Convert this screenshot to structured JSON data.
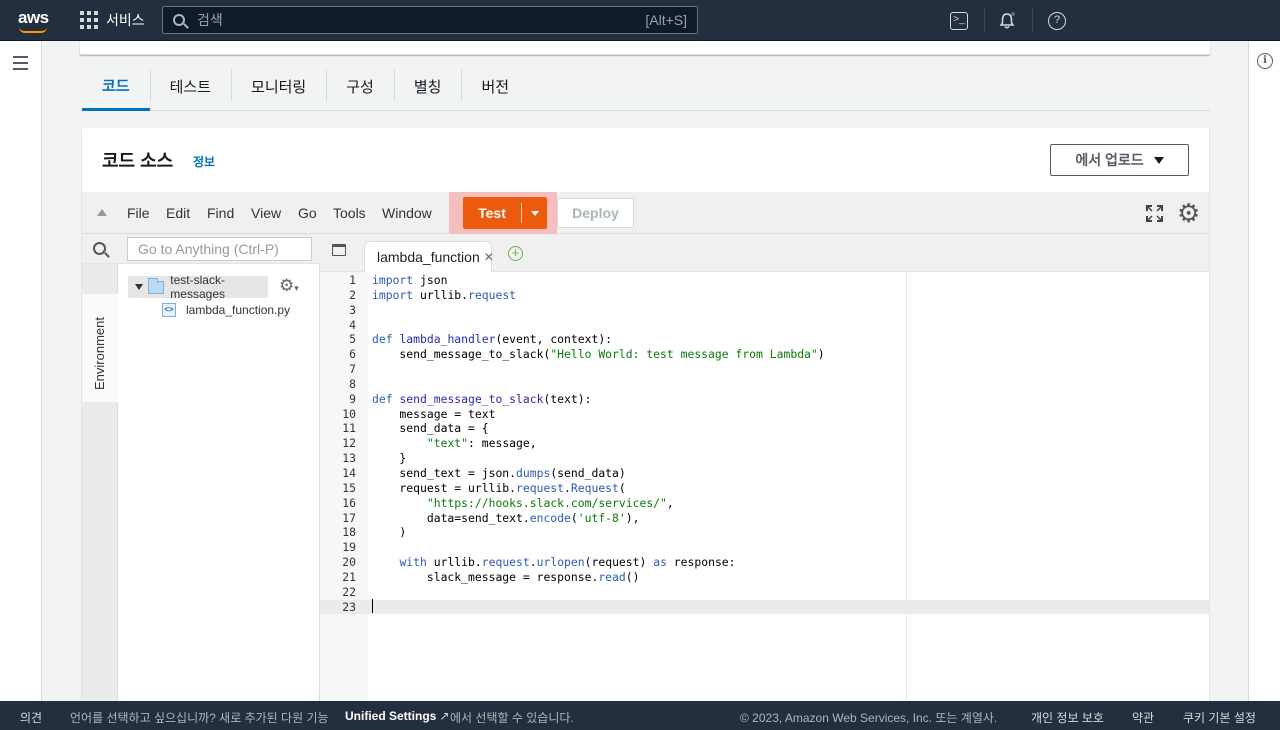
{
  "topnav": {
    "logo": "aws",
    "services_label": "서비스",
    "search_placeholder": "검색",
    "search_shortcut": "[Alt+S]",
    "icons": [
      "cloudshell-icon",
      "bell-icon",
      "help-icon"
    ]
  },
  "tabs": [
    {
      "label": "코드",
      "active": true
    },
    {
      "label": "테스트"
    },
    {
      "label": "모니터링"
    },
    {
      "label": "구성"
    },
    {
      "label": "별칭"
    },
    {
      "label": "버전"
    }
  ],
  "code_source": {
    "title": "코드 소스",
    "info_link": "정보",
    "upload_button": "에서 업로드"
  },
  "ide": {
    "menu": [
      "File",
      "Edit",
      "Find",
      "View",
      "Go",
      "Tools",
      "Window"
    ],
    "test_button": "Test",
    "deploy_button": "Deploy",
    "goto_placeholder": "Go to Anything (Ctrl-P)",
    "environment_tab": "Environment",
    "folder_name": "test-slack-messages",
    "file_name": "lambda_function.py",
    "editor_tab": "lambda_function",
    "active_line": 23,
    "code": [
      "import json",
      "import urllib.request",
      "",
      "",
      "def lambda_handler(event, context):",
      "    send_message_to_slack(\"Hello World: test message from Lambda\")",
      "",
      "",
      "def send_message_to_slack(text):",
      "    message = text",
      "    send_data = {",
      "        \"text\": message,",
      "    }",
      "    send_text = json.dumps(send_data)",
      "    request = urllib.request.Request(",
      "        \"https://hooks.slack.com/services/\",",
      "        data=send_text.encode('utf-8'),",
      "    )",
      "",
      "    with urllib.request.urlopen(request) as response:",
      "        slack_message = response.read()",
      "",
      ""
    ]
  },
  "footer": {
    "feedback": "의견",
    "language_prompt": "언어를 선택하고 싶으십니까? 새로 추가된 다원 기능",
    "unified_settings": "Unified Settings",
    "language_prompt_end": "에서 선택할 수 있습니다.",
    "copyright": "© 2023, Amazon Web Services, Inc. 또는 계열사.",
    "privacy": "개인 정보 보호",
    "terms": "약관",
    "cookies": "쿠키 기본 설정"
  },
  "colors": {
    "nav_bg": "#232f3e",
    "accent_blue": "#0073bb",
    "test_orange": "#ec5a0e",
    "highlight_pink": "#f5bfbf"
  }
}
